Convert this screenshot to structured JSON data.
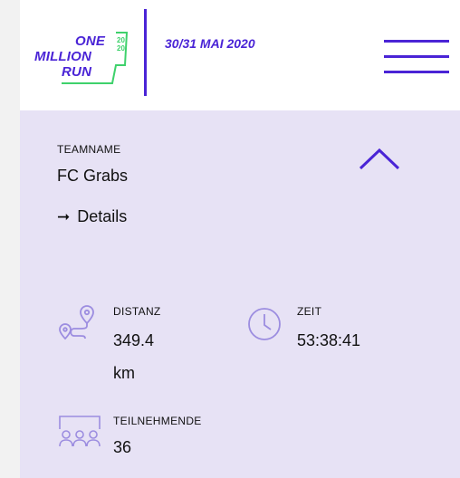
{
  "header": {
    "logo": {
      "line1": "ONE",
      "line2": "MILLION",
      "line3": "RUN",
      "year_top": "20",
      "year_bottom": "20"
    },
    "date": "30/31 MAI 2020",
    "menu_icon": "hamburger-menu-icon"
  },
  "team": {
    "label": "TEAMNAME",
    "name": "FC Grabs",
    "details_label": "Details",
    "details_icon": "arrow-right-icon",
    "collapse_icon": "chevron-up-icon"
  },
  "stats": {
    "distance": {
      "label": "DISTANZ",
      "value": "349.4",
      "unit": "km",
      "icon": "route-icon"
    },
    "time": {
      "label": "ZEIT",
      "value": "53:38:41",
      "icon": "clock-icon"
    },
    "participants": {
      "label": "TEILNEHMENDE",
      "value": "36",
      "icon": "group-icon"
    }
  },
  "colors": {
    "brand_purple": "#4a24d6",
    "brand_green": "#3ed16b",
    "panel_background": "#e7e2f5",
    "icon_lavender": "#9c8de0"
  }
}
